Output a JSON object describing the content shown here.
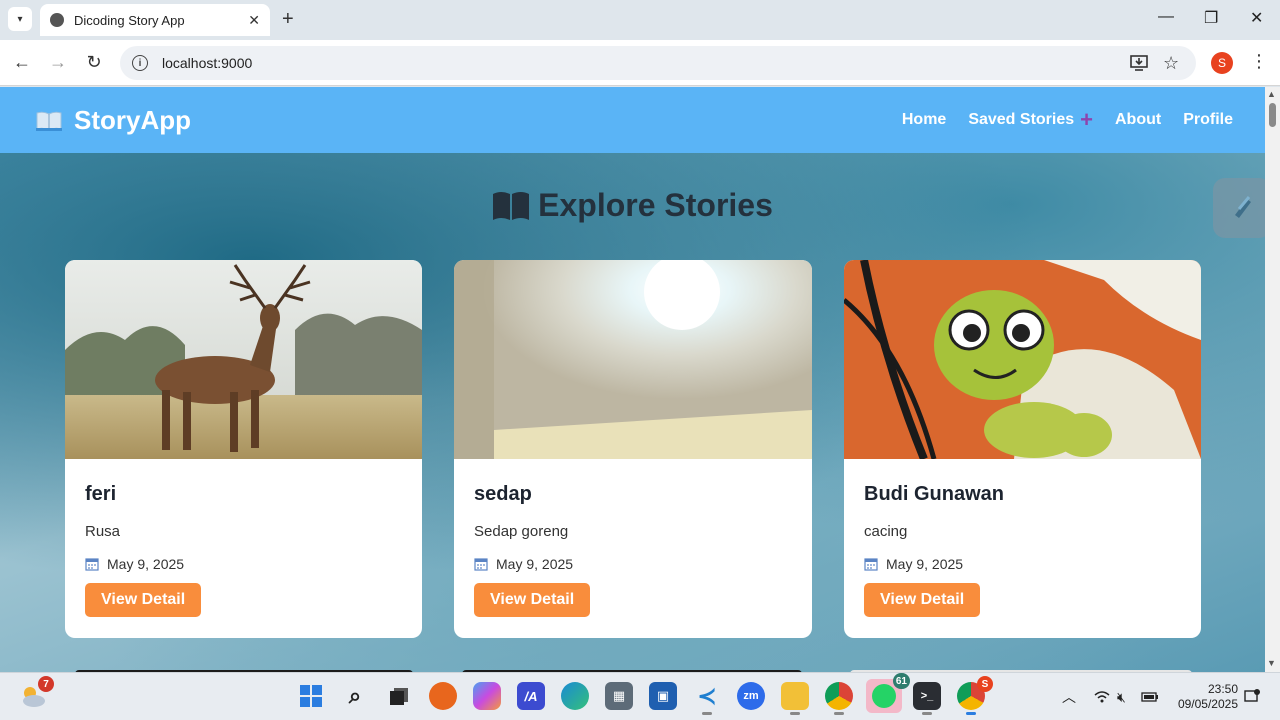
{
  "browser": {
    "tab_title": "Dicoding Story App",
    "url": "localhost:9000",
    "profile_initial": "S"
  },
  "app": {
    "brand": "StoryApp",
    "nav": {
      "home": "Home",
      "saved": "Saved Stories",
      "about": "About",
      "profile": "Profile"
    },
    "section_title": "Explore Stories",
    "stories": [
      {
        "name": "feri",
        "description": "Rusa",
        "date": "May 9, 2025",
        "button": "View Detail",
        "image": "deer"
      },
      {
        "name": "sedap",
        "description": "Sedap goreng",
        "date": "May 9, 2025",
        "button": "View Detail",
        "image": "ceiling-light"
      },
      {
        "name": "Budi Gunawan",
        "description": "cacing",
        "date": "May 9, 2025",
        "button": "View Detail",
        "image": "caterpillar-mural"
      }
    ]
  },
  "taskbar": {
    "weather_badge": "7",
    "whatsapp_badge": "61",
    "chrome_badge": "S",
    "time": "23:50",
    "date": "09/05/2025"
  },
  "colors": {
    "header": "#5ab4f6",
    "button": "#f98d3c",
    "plus": "#8e44ad"
  }
}
